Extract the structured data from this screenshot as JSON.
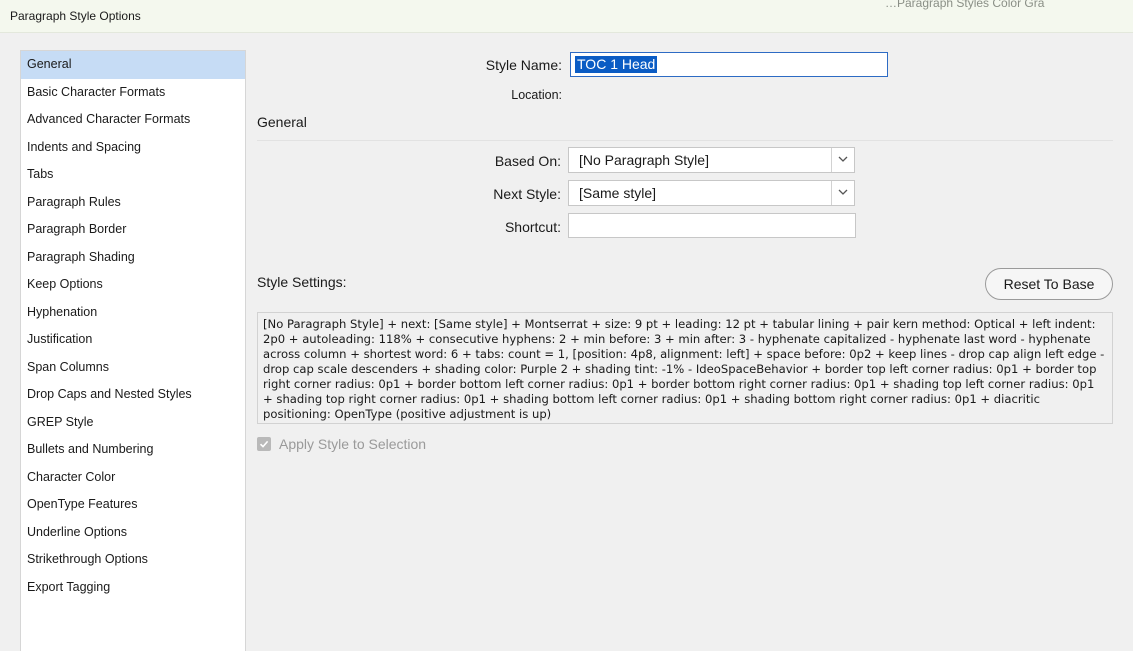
{
  "window": {
    "title": "Paragraph Style Options",
    "background_tab_text": "…Paragraph Styles   Color   Gra"
  },
  "sidebar": {
    "items": [
      {
        "label": "General",
        "selected": true
      },
      {
        "label": "Basic Character Formats"
      },
      {
        "label": "Advanced Character Formats"
      },
      {
        "label": "Indents and Spacing"
      },
      {
        "label": "Tabs"
      },
      {
        "label": "Paragraph Rules"
      },
      {
        "label": "Paragraph Border"
      },
      {
        "label": "Paragraph Shading"
      },
      {
        "label": "Keep Options"
      },
      {
        "label": "Hyphenation"
      },
      {
        "label": "Justification"
      },
      {
        "label": "Span Columns"
      },
      {
        "label": "Drop Caps and Nested Styles"
      },
      {
        "label": "GREP Style"
      },
      {
        "label": "Bullets and Numbering"
      },
      {
        "label": "Character Color"
      },
      {
        "label": "OpenType Features"
      },
      {
        "label": "Underline Options"
      },
      {
        "label": "Strikethrough Options"
      },
      {
        "label": "Export Tagging"
      }
    ]
  },
  "form": {
    "style_name_label": "Style Name:",
    "style_name_value": "TOC 1 Head",
    "location_label": "Location:",
    "section_title": "General",
    "based_on_label": "Based On:",
    "based_on_value": "[No Paragraph Style]",
    "next_style_label": "Next Style:",
    "next_style_value": "[Same style]",
    "shortcut_label": "Shortcut:",
    "shortcut_value": "",
    "style_settings_label": "Style Settings:",
    "reset_button": "Reset To Base",
    "style_settings_text": "[No Paragraph Style] + next: [Same style] + Montserrat + size: 9 pt + leading: 12 pt + tabular lining + pair kern method: Optical + left indent: 2p0 + autoleading: 118% + consecutive hyphens: 2 + min before: 3 + min after: 3 - hyphenate capitalized - hyphenate last word - hyphenate across column + shortest word: 6 + tabs: count = 1, [position: 4p8, alignment: left]  + space before: 0p2 + keep lines - drop cap align left edge - drop cap scale descenders + shading color: Purple 2 + shading tint: -1% - IdeoSpaceBehavior + border top left corner radius: 0p1 + border top right corner radius: 0p1 + border bottom left corner radius: 0p1 + border bottom right corner radius: 0p1 + shading top left corner radius: 0p1 + shading top right corner radius: 0p1 + shading bottom left corner radius: 0p1 + shading bottom right corner radius: 0p1 + diacritic positioning: OpenType (positive adjustment is up)",
    "apply_label": "Apply Style to Selection",
    "apply_checked": true
  },
  "colors": {
    "accent": "#0b5cc4",
    "selected_row": "#c6dcf5"
  }
}
